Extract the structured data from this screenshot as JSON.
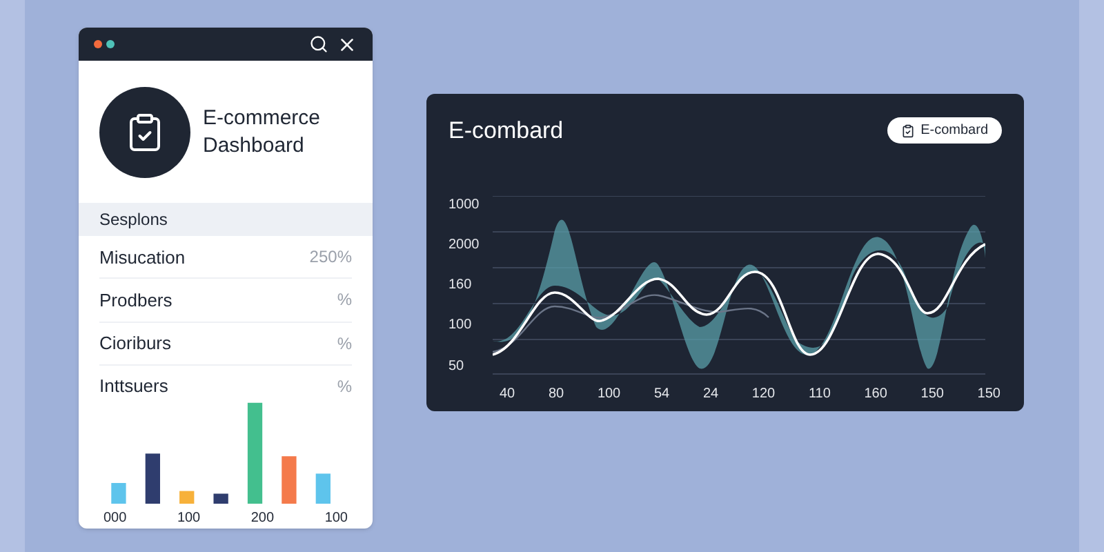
{
  "side_panel": {
    "title": "E-commerce Dashboard",
    "section": "Sesplons",
    "rows": [
      {
        "label": "Misucation",
        "value": "250%"
      },
      {
        "label": "Prodbers",
        "value": "%"
      },
      {
        "label": "Cioriburs",
        "value": "%"
      },
      {
        "label": "Inttsuers",
        "value": "%"
      }
    ],
    "bar_labels": [
      "000",
      "100",
      "200",
      "100"
    ]
  },
  "chart_card": {
    "title": "E-combard",
    "button": "E-combard",
    "y_labels": [
      "1000",
      "2000",
      "160",
      "100",
      "50"
    ],
    "x_labels": [
      "40",
      "80",
      "100",
      "54",
      "24",
      "120",
      "110",
      "160",
      "150",
      "150"
    ]
  }
}
